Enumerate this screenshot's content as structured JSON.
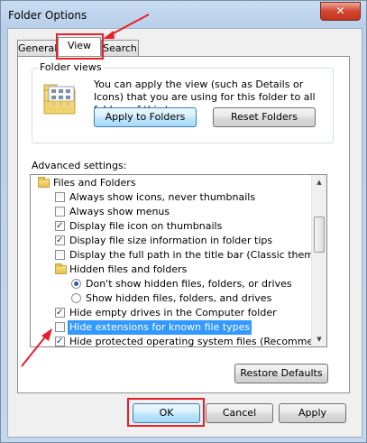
{
  "window": {
    "title": "Folder Options",
    "close_glyph": "✕"
  },
  "tabs": [
    {
      "label": "General"
    },
    {
      "label": "View"
    },
    {
      "label": "Search"
    }
  ],
  "folder_views": {
    "legend": "Folder views",
    "description": "You can apply the view (such as Details or Icons) that you are using for this folder to all folders of this type.",
    "apply_button": "Apply to Folders",
    "reset_button": "Reset Folders",
    "icon": "folder-views-icon"
  },
  "advanced": {
    "label": "Advanced settings:",
    "items": [
      {
        "type": "folder",
        "label": "Files and Folders"
      },
      {
        "type": "checkbox",
        "checked": false,
        "label": "Always show icons, never thumbnails"
      },
      {
        "type": "checkbox",
        "checked": false,
        "label": "Always show menus"
      },
      {
        "type": "checkbox",
        "checked": true,
        "label": "Display file icon on thumbnails"
      },
      {
        "type": "checkbox",
        "checked": true,
        "label": "Display file size information in folder tips"
      },
      {
        "type": "checkbox",
        "checked": false,
        "label": "Display the full path in the title bar (Classic theme only)"
      },
      {
        "type": "folder",
        "label": "Hidden files and folders"
      },
      {
        "type": "radio",
        "checked": true,
        "label": "Don't show hidden files, folders, or drives"
      },
      {
        "type": "radio",
        "checked": false,
        "label": "Show hidden files, folders, and drives"
      },
      {
        "type": "checkbox",
        "checked": true,
        "label": "Hide empty drives in the Computer folder"
      },
      {
        "type": "checkbox",
        "checked": false,
        "label": "Hide extensions for known file types",
        "selected": true
      },
      {
        "type": "checkbox",
        "checked": true,
        "label": "Hide protected operating system files (Recommended)"
      }
    ],
    "restore_button": "Restore Defaults"
  },
  "footer": {
    "ok": "OK",
    "cancel": "Cancel",
    "apply": "Apply"
  },
  "colors": {
    "annotation_red": "#e6202a",
    "selection_blue": "#3399ff"
  }
}
